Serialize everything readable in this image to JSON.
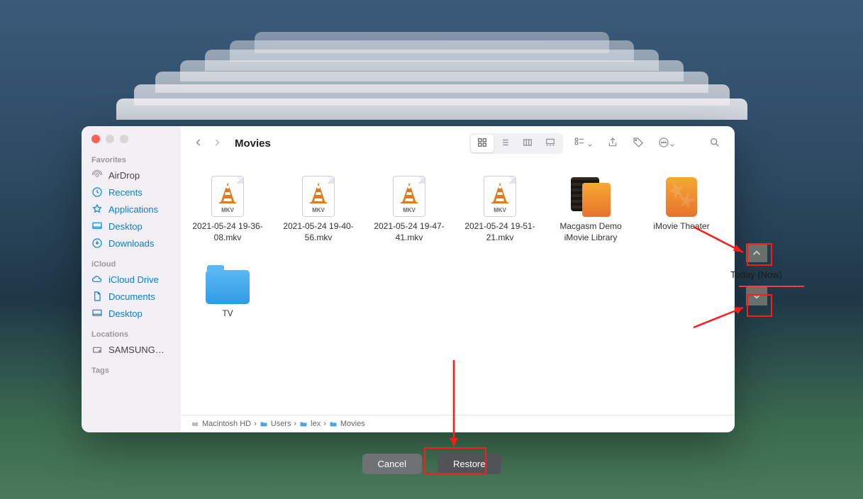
{
  "window": {
    "title": "Movies"
  },
  "sidebar": {
    "sections": [
      {
        "header": "Favorites",
        "items": [
          {
            "icon": "airdrop-icon",
            "label": "AirDrop"
          },
          {
            "icon": "recents-icon",
            "label": "Recents"
          },
          {
            "icon": "applications-icon",
            "label": "Applications"
          },
          {
            "icon": "desktop-icon",
            "label": "Desktop"
          },
          {
            "icon": "downloads-icon",
            "label": "Downloads"
          }
        ]
      },
      {
        "header": "iCloud",
        "items": [
          {
            "icon": "icloud-icon",
            "label": "iCloud Drive"
          },
          {
            "icon": "documents-icon",
            "label": "Documents"
          },
          {
            "icon": "desktop-icon",
            "label": "Desktop"
          }
        ]
      },
      {
        "header": "Locations",
        "items": [
          {
            "icon": "external-disk-icon",
            "label": "SAMSUNG…"
          }
        ]
      },
      {
        "header": "Tags",
        "items": []
      }
    ]
  },
  "files": [
    {
      "type": "mkv",
      "name": "2021-05-24 19-36-08.mkv"
    },
    {
      "type": "mkv",
      "name": "2021-05-24 19-40-56.mkv"
    },
    {
      "type": "mkv",
      "name": "2021-05-24 19-47-41.mkv"
    },
    {
      "type": "mkv",
      "name": "2021-05-24 19-51-21.mkv"
    },
    {
      "type": "imovlib",
      "name": "Macgasm Demo iMovie Library"
    },
    {
      "type": "theater",
      "name": "iMovie Theater"
    },
    {
      "type": "folder",
      "name": "TV"
    }
  ],
  "pathbar": [
    "Macintosh HD",
    "Users",
    "lex",
    "Movies"
  ],
  "timeline": {
    "label": "Today (Now)"
  },
  "buttons": {
    "cancel": "Cancel",
    "restore": "Restore"
  },
  "mkvTag": "MKV",
  "colors": {
    "annotation": "#ff1a1a",
    "accent": "#0b7dda"
  }
}
